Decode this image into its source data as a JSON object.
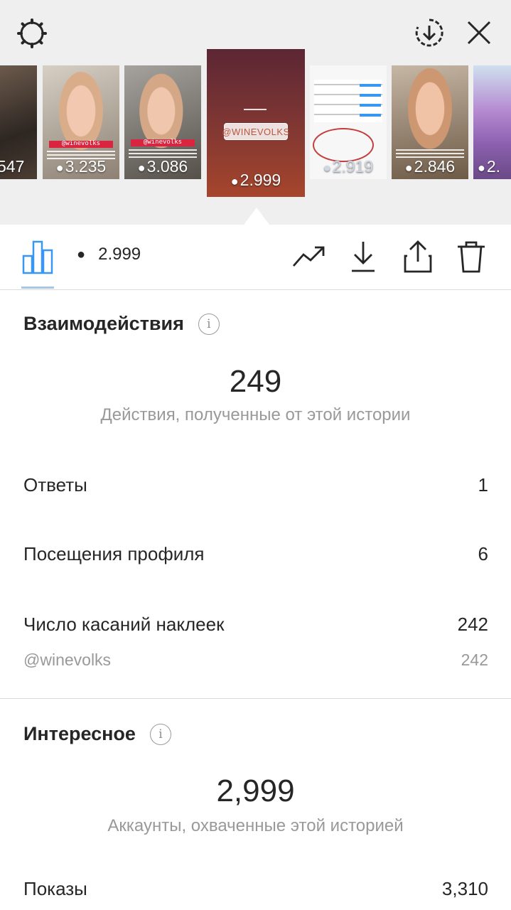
{
  "stories": [
    {
      "views": "547"
    },
    {
      "views": "3.235",
      "caption": "@winevolks"
    },
    {
      "views": "3.086",
      "caption": "@winevolks"
    },
    {
      "views": "2.999",
      "sticker": "@WINEVOLKS"
    },
    {
      "views": "2.919"
    },
    {
      "views": "2.846"
    },
    {
      "views": "2."
    }
  ],
  "toolbar": {
    "views": "2.999",
    "icons": [
      "bar-chart-icon",
      "eye-icon",
      "trending-icon",
      "download-icon",
      "share-icon",
      "trash-icon"
    ]
  },
  "interactions": {
    "title": "Взаимодействия",
    "total": "249",
    "subtitle": "Действия, полученные от этой истории",
    "rows": [
      {
        "label": "Ответы",
        "value": "1"
      },
      {
        "label": "Посещения профиля",
        "value": "6"
      },
      {
        "label": "Число касаний наклеек",
        "value": "242"
      }
    ],
    "sticker": {
      "label": "@winevolks",
      "value": "242"
    }
  },
  "discovery": {
    "title": "Интересное",
    "total": "2,999",
    "subtitle": "Аккаунты, охваченные этой историей",
    "rows": [
      {
        "label": "Показы",
        "value": "3,310"
      }
    ]
  },
  "colors": {
    "accent": "#3897f0",
    "story_active_top": "#6b2a3a",
    "story_active_bottom": "#a6452d"
  }
}
